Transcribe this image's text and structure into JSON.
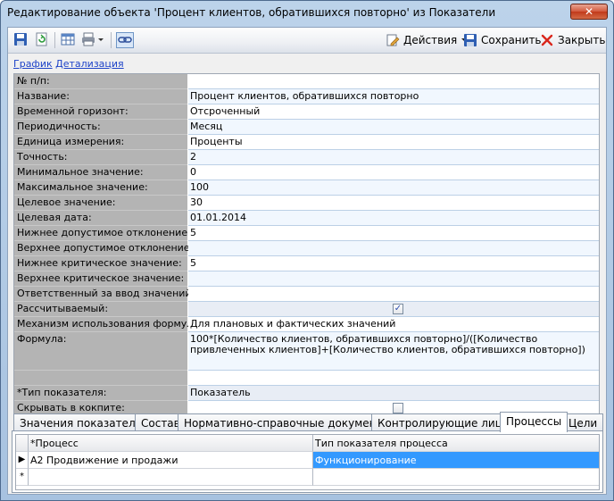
{
  "window": {
    "title": "Редактирование объекта 'Процент клиентов, обратившихся повторно' из Показатели",
    "close_glyph": "✕"
  },
  "toolbar": {
    "icons": [
      "save-icon",
      "refresh-icon",
      "table-icon",
      "print-icon",
      "link-icon"
    ],
    "actions_label": "Действия",
    "save_label": "Сохранить",
    "close_label": "Закрыть"
  },
  "links": {
    "graph": "График",
    "detail": "Детализация"
  },
  "properties": [
    {
      "label": "№ п/п:",
      "value": ""
    },
    {
      "label": "Название:",
      "value": "Процент клиентов, обратившихся повторно"
    },
    {
      "label": "Временной горизонт:",
      "value": "Отсроченный"
    },
    {
      "label": "Периодичность:",
      "value": "Месяц"
    },
    {
      "label": "Единица измерения:",
      "value": "Проценты"
    },
    {
      "label": "Точность:",
      "value": "2"
    },
    {
      "label": "Минимальное значение:",
      "value": "0"
    },
    {
      "label": "Максимальное значение:",
      "value": "100"
    },
    {
      "label": "Целевое значение:",
      "value": "30"
    },
    {
      "label": "Целевая дата:",
      "value": "01.01.2014"
    },
    {
      "label": "Нижнее допустимое отклонение:",
      "value": "5"
    },
    {
      "label": "Верхнее допустимое отклонение:",
      "value": ""
    },
    {
      "label": "Нижнее критическое значение:",
      "value": "5"
    },
    {
      "label": "Верхнее критическое значение:",
      "value": ""
    },
    {
      "label": "Ответственный за ввод значений:",
      "value": ""
    },
    {
      "label": "Рассчитываемый:",
      "checked": true
    },
    {
      "label": "Механизм использования формулы:",
      "value": "Для плановых и фактических значений"
    },
    {
      "label": "Формула:",
      "value": "100*[Количество клиентов, обратившихся повторно]/([Количество привлеченных клиентов]+[Количество клиентов, обратившихся повторно])"
    },
    {
      "label": "*Тип показателя:",
      "value": "Показатель"
    },
    {
      "label": "Скрывать в кокпите:",
      "checked": false
    }
  ],
  "check_glyph": "✓",
  "tabs": [
    {
      "label": "Значения показателя"
    },
    {
      "label": "Состав"
    },
    {
      "label": "Нормативно-справочные документы"
    },
    {
      "label": "Контролирующие лица"
    },
    {
      "label": "Процессы",
      "active": true
    },
    {
      "label": "Цели"
    }
  ],
  "process_grid": {
    "headers": [
      "*Процесс",
      "Тип показателя процесса"
    ],
    "rows": [
      {
        "indicator": "▶",
        "process": "A2 Продвижение и продажи",
        "type": "Функционирование"
      }
    ],
    "new_row_indicator": "*"
  }
}
